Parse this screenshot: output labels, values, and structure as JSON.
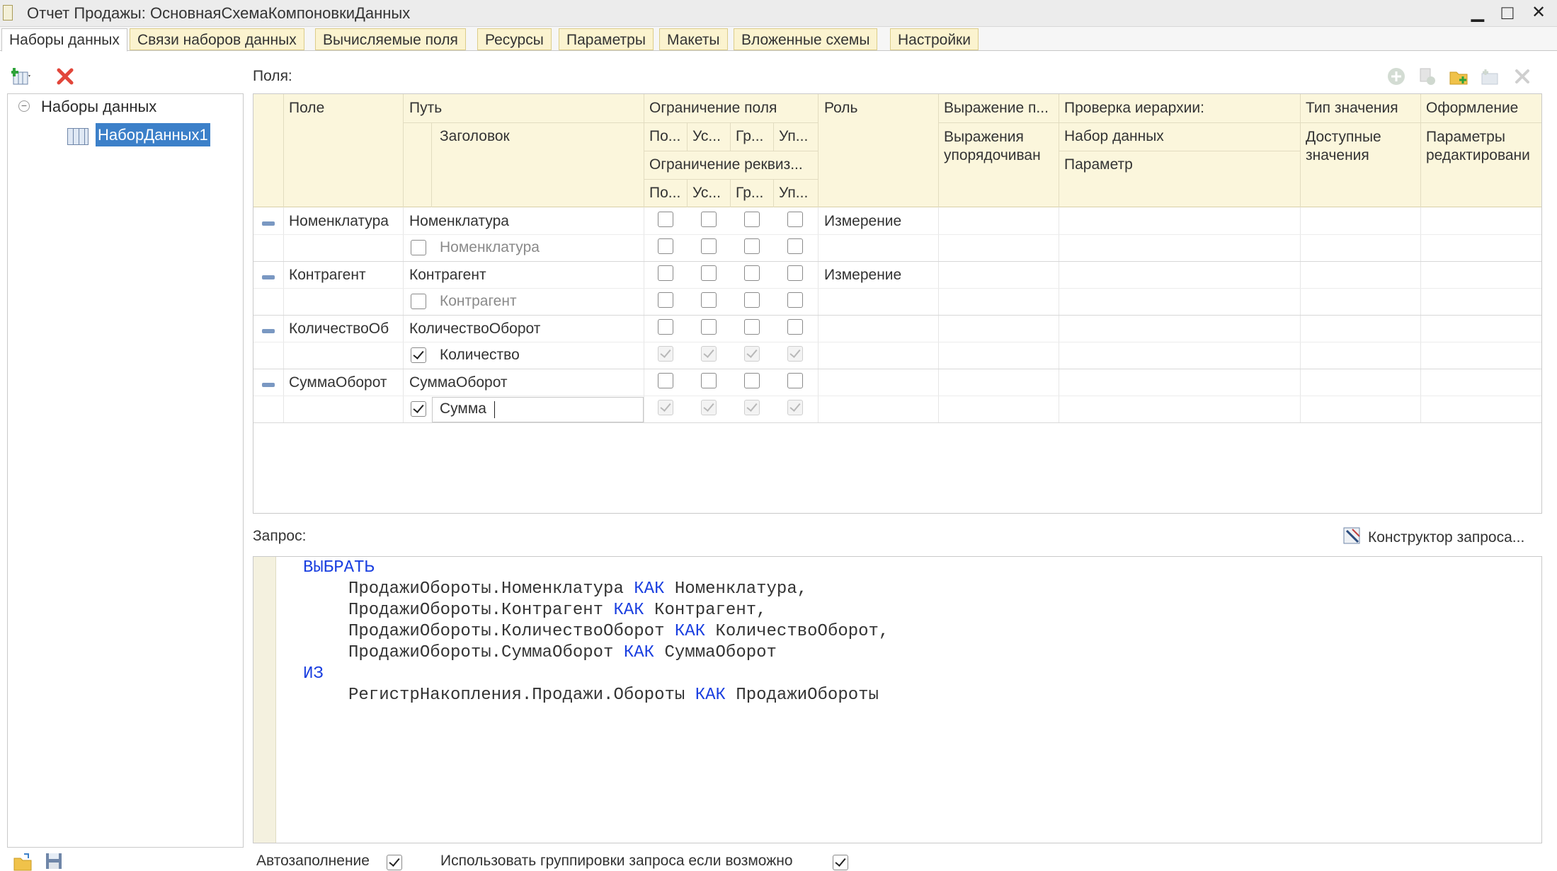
{
  "window": {
    "title": "Отчет Продажы: ОсновнаяСхемаКомпоновкиДанных",
    "minimize": "▁",
    "maximize": "□",
    "close": "✕"
  },
  "tabs": [
    "Наборы данных",
    "Связи наборов данных",
    "Вычисляемые поля",
    "Ресурсы",
    "Параметры",
    "Макеты",
    "Вложенные схемы",
    "Настройки"
  ],
  "left": {
    "add_icon": "add-dataset-icon",
    "delete_icon": "delete-icon",
    "tree_root": "Наборы данных",
    "tree_item": "НаборДанных1"
  },
  "fields_label": "Поля:",
  "headers": {
    "pole": "Поле",
    "put": "Путь",
    "zagolovok": "Заголовок",
    "ogr_polya": "Ограничение поля",
    "ogr_rekv": "Ограничение реквиз...",
    "po": "По...",
    "us": "Ус...",
    "gr": "Гр...",
    "up": "Уп...",
    "rol": "Роль",
    "vyrazh": "Выражение п...",
    "vyrazh_upor": "Выражения упорядочиван",
    "proverka": "Проверка иерархии:",
    "nabor": "Набор данных",
    "parametr": "Параметр",
    "tip": "Тип значения",
    "dostup": "Доступные значения",
    "oform": "Оформление",
    "param_red": "Параметры редактировани"
  },
  "rows": [
    {
      "pole": "Номенклатура",
      "put": "Номенклатура",
      "title": "Номенклатура",
      "title_checked": false,
      "role": "Измерение",
      "r1": [
        false,
        false,
        false,
        false
      ],
      "r2": [
        false,
        false,
        false,
        false
      ],
      "r2_disabled": false
    },
    {
      "pole": "Контрагент",
      "put": "Контрагент",
      "title": "Контрагент",
      "title_checked": false,
      "role": "Измерение",
      "r1": [
        false,
        false,
        false,
        false
      ],
      "r2": [
        false,
        false,
        false,
        false
      ],
      "r2_disabled": false
    },
    {
      "pole": "КоличествоОб",
      "put": "КоличествоОборот",
      "title": "Количество",
      "title_checked": true,
      "role": "",
      "r1": [
        false,
        false,
        false,
        false
      ],
      "r2": [
        true,
        true,
        true,
        true
      ],
      "r2_disabled": true
    },
    {
      "pole": "СуммаОборот",
      "put": "СуммаОборот",
      "title": "Сумма",
      "title_checked": true,
      "role": "",
      "r1": [
        false,
        false,
        false,
        false
      ],
      "r2": [
        true,
        true,
        true,
        true
      ],
      "r2_disabled": true
    }
  ],
  "query_label": "Запрос:",
  "query_builder": "Конструктор запроса...",
  "query": {
    "select_kw": "ВЫБРАТЬ",
    "lines": [
      {
        "expr": "ПродажиОбороты.Номенклатура",
        "kw": "КАК",
        "alias": "Номенклатура,"
      },
      {
        "expr": "ПродажиОбороты.Контрагент",
        "kw": "КАК",
        "alias": "Контрагент,"
      },
      {
        "expr": "ПродажиОбороты.КоличествоОборот",
        "kw": "КАК",
        "alias": "КоличествоОборот,"
      },
      {
        "expr": "ПродажиОбороты.СуммаОборот",
        "kw": "КАК",
        "alias": "СуммаОборот"
      }
    ],
    "from_kw": "ИЗ",
    "from": {
      "expr": "РегистрНакопления.Продажи.Обороты",
      "kw": "КАК",
      "alias": "ПродажиОбороты"
    }
  },
  "bottom": {
    "autofill": "Автозаполнение",
    "autofill_checked": true,
    "use_groupings": "Использовать группировки запроса если возможно",
    "use_groupings_checked": true
  }
}
